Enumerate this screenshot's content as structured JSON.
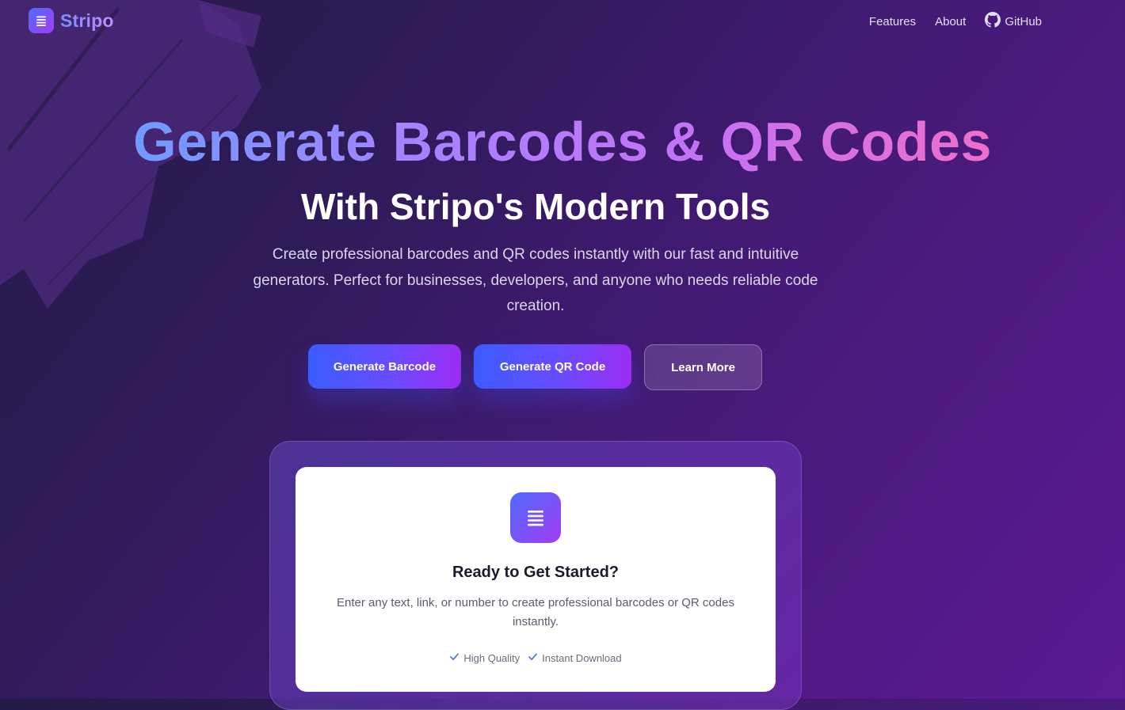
{
  "header": {
    "brand": "Stripo",
    "nav": [
      {
        "label": "Features"
      },
      {
        "label": "About"
      },
      {
        "label": "GitHub",
        "icon": "github-icon"
      }
    ]
  },
  "hero": {
    "title": "Generate Barcodes & QR Codes",
    "subtitle": "With Stripo's Modern Tools",
    "description": "Create professional barcodes and QR codes instantly with our fast and intuitive generators. Perfect for businesses, developers, and anyone who needs reliable code creation.",
    "buttons": {
      "barcode": "Generate Barcode",
      "qr": "Generate QR Code",
      "learn": "Learn More"
    }
  },
  "card": {
    "icon": "menu-lines-icon",
    "title": "Ready to Get Started?",
    "description": "Enter any text, link, or number to create professional barcodes or QR codes instantly.",
    "features": [
      {
        "label": "High Quality",
        "icon": "check-icon"
      },
      {
        "label": "Instant Download",
        "icon": "check-icon"
      }
    ]
  },
  "colors": {
    "accent_blue": "#3a5cff",
    "accent_purple": "#9c2cf2",
    "gradient_pink": "#ee6fc9",
    "background_dark": "#241a45",
    "background_purple": "#5a1a93"
  }
}
